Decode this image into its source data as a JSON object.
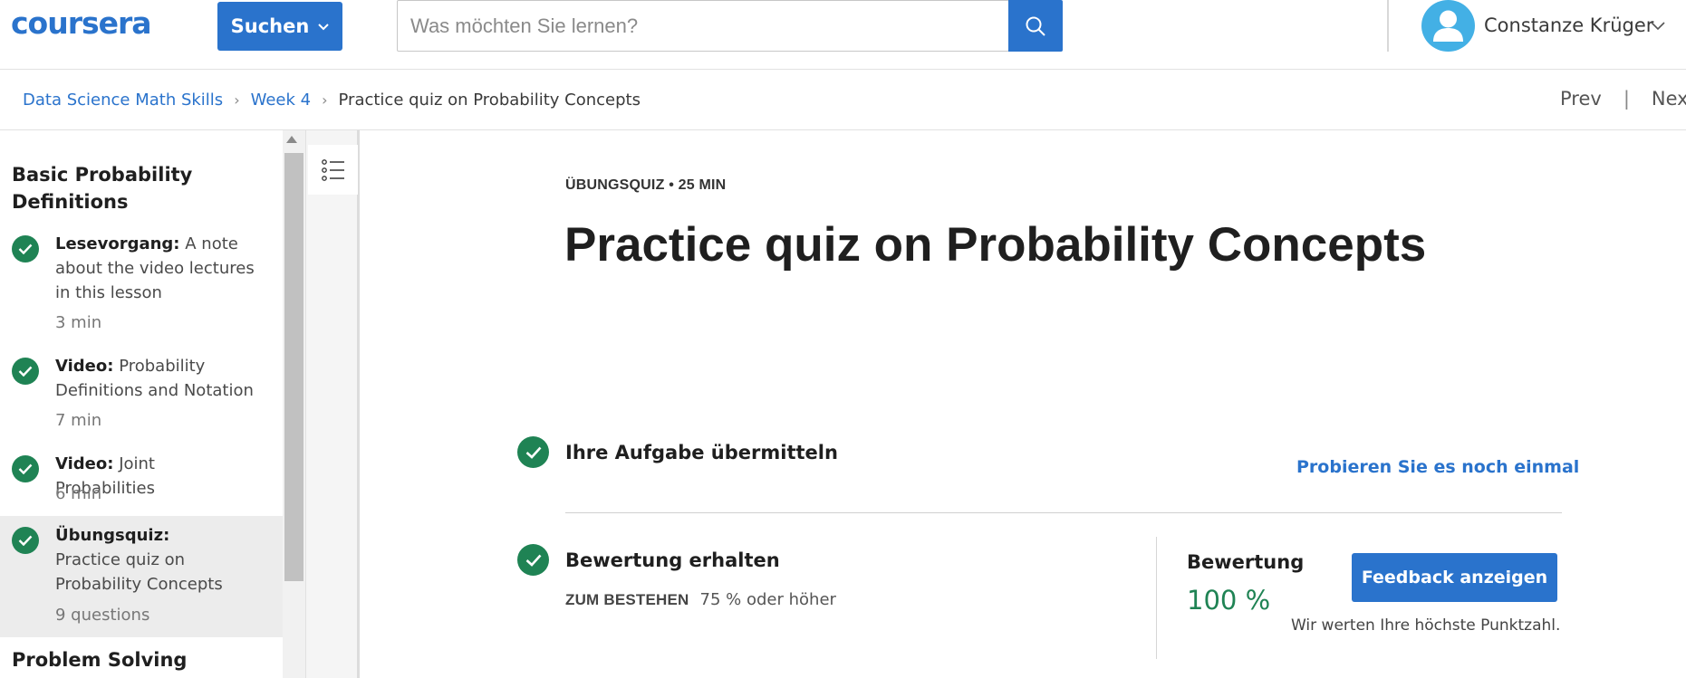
{
  "header": {
    "logo": "coursera",
    "search_button": "Suchen",
    "search_placeholder": "Was möchten Sie lernen?",
    "user_name": "Constanze Krüger"
  },
  "breadcrumb": {
    "items": [
      "Data Science Math Skills",
      "Week 4"
    ],
    "current": "Practice quiz on Probability Concepts",
    "prev": "Prev",
    "separator": "|",
    "next": "Next"
  },
  "sidebar": {
    "section_title": "Basic Probability Definitions",
    "items": [
      {
        "type": "Lesevorgang:",
        "title": "A note about the video lectures in this lesson",
        "meta": "3 min"
      },
      {
        "type": "Video:",
        "title": "Probability Definitions and Notation",
        "meta": "7 min"
      },
      {
        "type": "Video:",
        "title": "Joint Probabilities",
        "meta": "6 min"
      },
      {
        "type": "Übungsquiz:",
        "title": "Practice quiz on Probability Concepts",
        "meta": "9 questions"
      }
    ],
    "next_section_title": "Problem Solving"
  },
  "main": {
    "eyebrow": "ÜBUNGSQUIZ • 25 MIN",
    "title": "Practice quiz on Probability Concepts",
    "step1_title": "Ihre Aufgabe übermitteln",
    "retry_link": "Probieren Sie es noch einmal",
    "step2_title": "Bewertung erhalten",
    "pass_label": "ZUM BESTEHEN",
    "pass_value": "75 % oder höher",
    "grade_label": "Bewertung",
    "grade_value": "100 %",
    "feedback_button": "Feedback anzeigen",
    "grade_note": "Wir werten Ihre höchste Punktzahl."
  },
  "colors": {
    "brand_blue": "#2a73cc",
    "success_green": "#1f8354",
    "avatar_blue": "#43b0e5"
  }
}
